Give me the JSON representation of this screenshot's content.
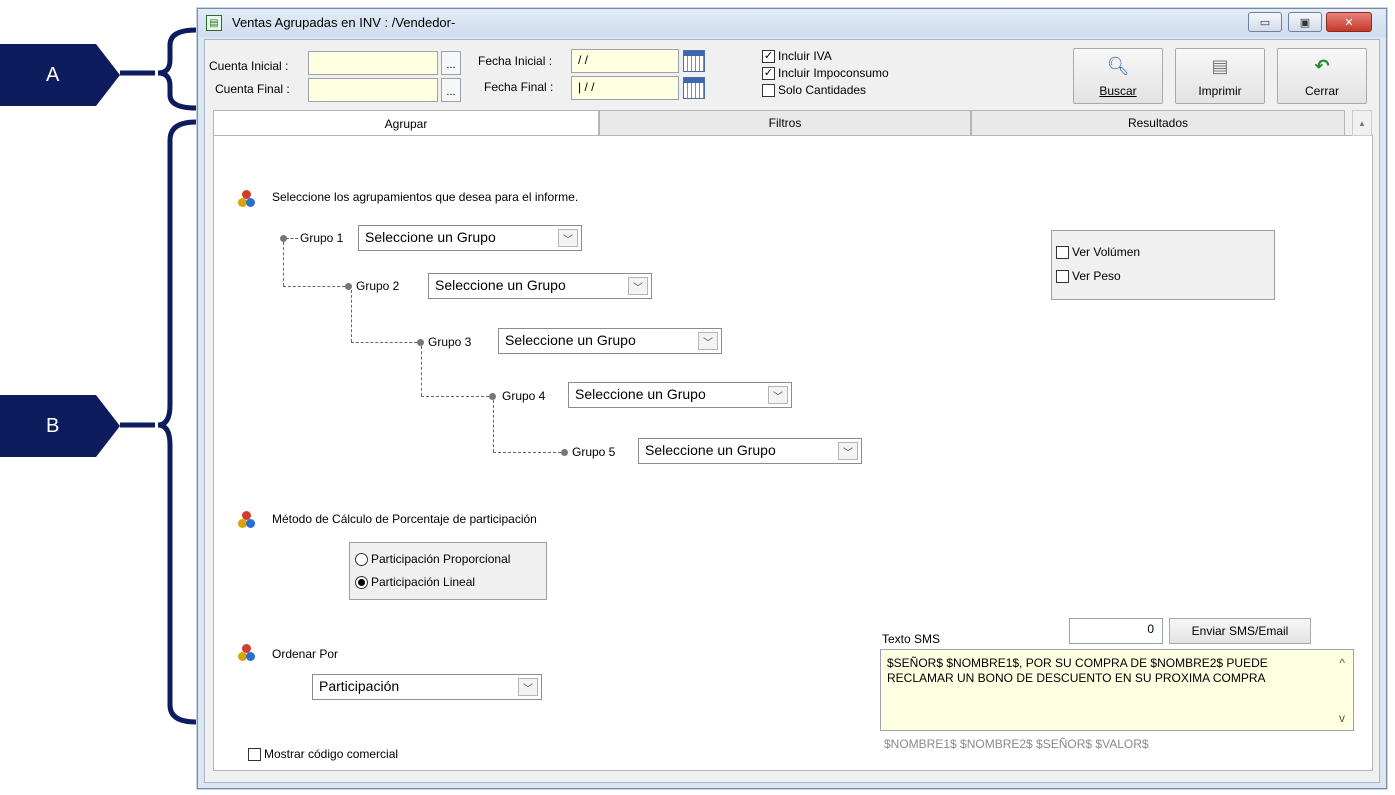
{
  "annotations": {
    "a": "A",
    "b": "B"
  },
  "window": {
    "title": "Ventas Agrupadas en INV : /Vendedor-",
    "minimize": "▭",
    "restore": "▣",
    "close": "✕"
  },
  "params": {
    "cuenta_inicial_label": "Cuenta Inicial :",
    "cuenta_final_label": "Cuenta Final :",
    "cuenta_inicial_value": "",
    "cuenta_final_value": "",
    "ellipsis": "...",
    "fecha_inicial_label": "Fecha Inicial :",
    "fecha_final_label": "Fecha Final :",
    "fecha_inicial_value": " / /",
    "fecha_final_value": "| / /",
    "incluir_iva": "Incluir IVA",
    "incluir_impoconsumo": "Incluir Impoconsumo",
    "solo_cantidades": "Solo Cantidades",
    "check_mark": "✓"
  },
  "toolbar": {
    "buscar": "Buscar",
    "imprimir": "Imprimir",
    "cerrar": "Cerrar"
  },
  "tabs": [
    "Agrupar",
    "Filtros",
    "Resultados"
  ],
  "agrupar": {
    "intro": "Seleccione los agrupamientos que desea para el informe.",
    "groups": [
      {
        "label": "Grupo 1",
        "value": "Seleccione un Grupo"
      },
      {
        "label": "Grupo 2",
        "value": "Seleccione un Grupo"
      },
      {
        "label": "Grupo 3",
        "value": "Seleccione un Grupo"
      },
      {
        "label": "Grupo 4",
        "value": "Seleccione un Grupo"
      },
      {
        "label": "Grupo 5",
        "value": "Seleccione un Grupo"
      }
    ],
    "ver_volumen": "Ver Volúmen",
    "ver_peso": "Ver Peso",
    "metodo_title": "Método de Cálculo de Porcentaje de participación",
    "participacion_proporcional": "Participación Proporcional",
    "participacion_lineal": "Participación Lineal",
    "ordenar_title": "Ordenar Por",
    "ordenar_value": "Participación",
    "mostrar_codigo": "Mostrar código comercial",
    "dropdown_arrow": "﹀"
  },
  "sms": {
    "label": "Texto SMS",
    "count": "0",
    "send_button": "Enviar SMS/Email",
    "text": "$SEÑOR$ $NOMBRE1$, POR SU COMPRA DE $NOMBRE2$ PUEDE RECLAMAR UN BONO DE DESCUENTO EN SU PROXIMA COMPRA",
    "tokens": "$NOMBRE1$  $NOMBRE2$  $SEÑOR$  $VALOR$",
    "scroll_up": "^",
    "scroll_down": "v"
  }
}
